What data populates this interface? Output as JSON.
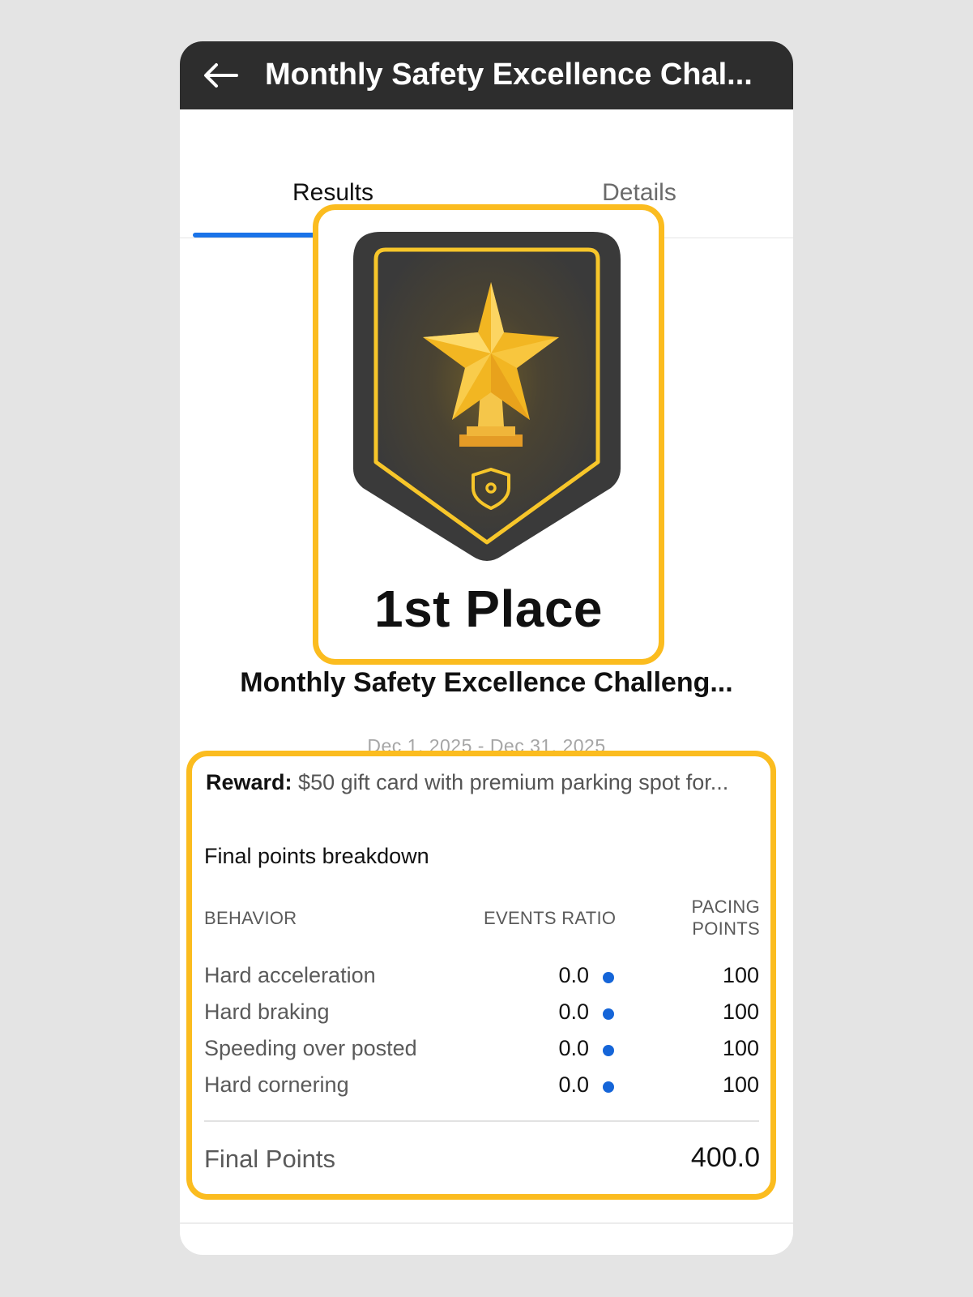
{
  "appbar": {
    "back_icon": "arrow-left-icon",
    "title": "Monthly Safety Excellence Chal..."
  },
  "tabs": [
    {
      "label": "Results",
      "active": true
    },
    {
      "label": "Details",
      "active": false
    }
  ],
  "badge": {
    "icon": "star-trophy-icon",
    "sub_icon": "shield-icon",
    "place": "1st Place"
  },
  "challenge": {
    "name": "Monthly Safety Excellence Challeng...",
    "date_range": "Dec 1, 2025 - Dec 31, 2025"
  },
  "reward": {
    "label": "Reward:",
    "text": "$50 gift card with premium parking spot for..."
  },
  "breakdown": {
    "title": "Final points breakdown",
    "headers": {
      "behavior": "BEHAVIOR",
      "events_ratio": "EVENTS RATIO",
      "pacing_points_line1": "PACING",
      "pacing_points_line2": "POINTS"
    },
    "rows": [
      {
        "behavior": "Hard acceleration",
        "ratio": "0.0",
        "points": "100"
      },
      {
        "behavior": "Hard braking",
        "ratio": "0.0",
        "points": "100"
      },
      {
        "behavior": "Speeding over posted",
        "ratio": "0.0",
        "points": "100"
      },
      {
        "behavior": "Hard cornering",
        "ratio": "0.0",
        "points": "100"
      }
    ],
    "final_label": "Final Points",
    "final_value": "400.0"
  },
  "colors": {
    "accent_yellow": "#fbbc1f",
    "tab_indicator": "#1a73e8",
    "appbar": "#2d2d2d",
    "status_dot": "#1565d8"
  }
}
